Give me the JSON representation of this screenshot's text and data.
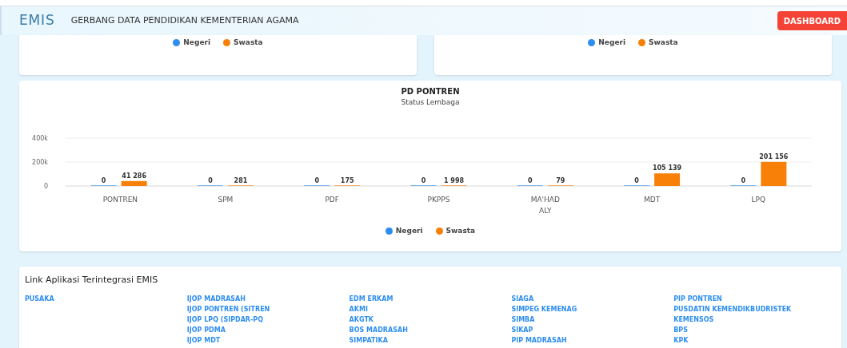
{
  "header": {
    "logo": "EMIS",
    "title": "GERBANG DATA PENDIDIKAN KEMENTERIAN AGAMA",
    "button": "DASHBOARD"
  },
  "top_cards": [
    {
      "legend": [
        {
          "name": "Negeri",
          "color": "#2e8ef0"
        },
        {
          "name": "Swasta",
          "color": "#f98008"
        }
      ]
    },
    {
      "legend": [
        {
          "name": "Negeri",
          "color": "#2e8ef0"
        },
        {
          "name": "Swasta",
          "color": "#f98008"
        }
      ]
    }
  ],
  "chart_card": {
    "title": "PD PONTREN",
    "subtitle": "Status Lembaga",
    "chart_data": {
      "type": "bar",
      "categories": [
        "PONTREN",
        "SPM",
        "PDF",
        "PKPPS",
        "MA'HAD ALY",
        "MDT",
        "LPQ"
      ],
      "series": [
        {
          "name": "Negeri",
          "color": "#2e8ef0",
          "values": [
            0,
            0,
            0,
            0,
            0,
            0,
            0
          ]
        },
        {
          "name": "Swasta",
          "color": "#f98008",
          "values": [
            41286,
            281,
            175,
            1998,
            79,
            105139,
            201156
          ]
        }
      ],
      "ylim": [
        0,
        400000
      ],
      "yticks": [
        {
          "value": 0,
          "label": "0"
        },
        {
          "value": 200000,
          "label": "200k"
        },
        {
          "value": 400000,
          "label": "400k"
        }
      ],
      "data_labels": true,
      "legend": "bottom"
    }
  },
  "links": {
    "title": "Link Aplikasi Terintegrasi EMIS",
    "columns": [
      [
        "PUSAKA"
      ],
      [
        "IJOP MADRASAH",
        "IJOP PONTREN (SITREN",
        "IJOP LPQ (SIPDAR-PQ",
        "IJOP PDMA",
        "IJOP MDT"
      ],
      [
        "EDM ERKAM",
        "AKMI",
        "AKGTK",
        "BOS MADRASAH",
        "SIMPATIKA"
      ],
      [
        "SIAGA",
        "SIMPEG KEMENAG",
        "SIMBA",
        "SIKAP",
        "PIP MADRASAH"
      ],
      [
        "PIP PONTREN",
        "PUSDATIN KEMENDIKBUDRISTEK",
        "KEMENSOS",
        "BPS",
        "KPK"
      ]
    ]
  }
}
